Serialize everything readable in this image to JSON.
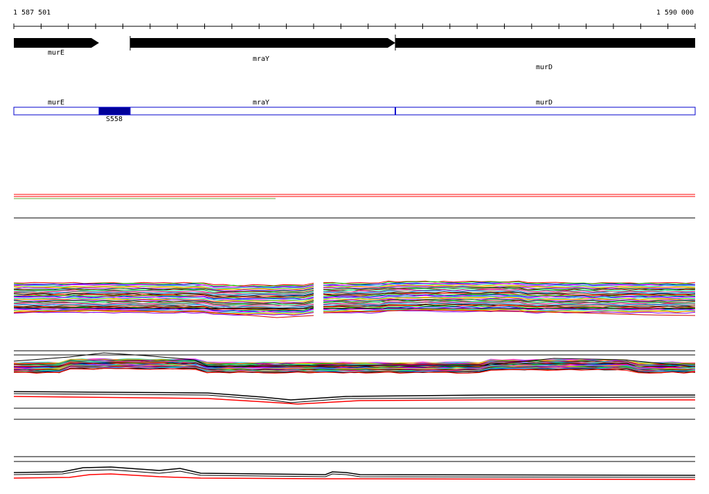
{
  "ruler": {
    "start_label": "1 587 501",
    "end_label": "1 590 000"
  },
  "genes": [
    {
      "name": "murE",
      "strand": "+"
    },
    {
      "name": "mraY",
      "strand": "+"
    },
    {
      "name": "murD",
      "strand": "+"
    }
  ],
  "annotation_track": {
    "labels": [
      "murE",
      "mraY",
      "murD"
    ],
    "feature_label": "S558"
  },
  "colors": {
    "gene_arrow": "#000000",
    "annotation_outline": "#0000cc",
    "feature_fill": "#000099",
    "highlight_line": "#ff0000",
    "secondary_line": "#66aa33"
  }
}
